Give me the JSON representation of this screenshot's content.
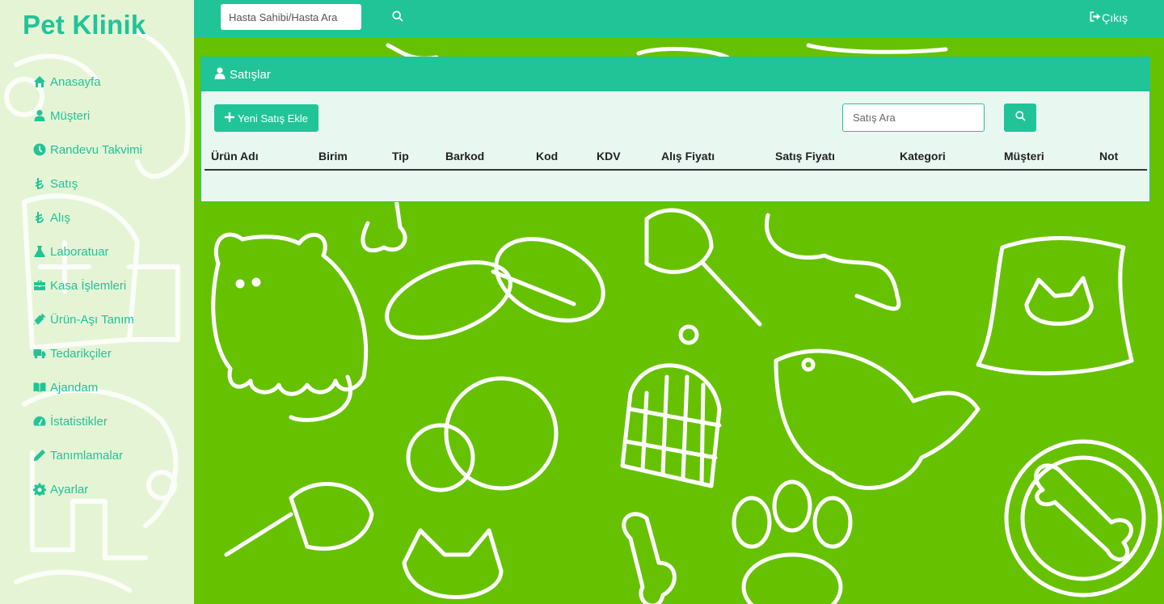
{
  "app": {
    "brand": "Pet Klinik"
  },
  "topbar": {
    "search_placeholder": "Hasta Sahibi/Hasta Ara",
    "logout_label": "Çıkış"
  },
  "sidebar": {
    "items": [
      {
        "label": "Anasayfa",
        "icon": "home-icon"
      },
      {
        "label": "Müşteri",
        "icon": "user-icon"
      },
      {
        "label": "Randevu Takvimi",
        "icon": "clock-icon"
      },
      {
        "label": "Satış",
        "icon": "lira-icon"
      },
      {
        "label": "Alış",
        "icon": "lira-icon"
      },
      {
        "label": "Laboratuar",
        "icon": "flask-icon"
      },
      {
        "label": "Kasa İşlemleri",
        "icon": "briefcase-icon"
      },
      {
        "label": "Ürün-Aşı Tanım",
        "icon": "syringe-icon"
      },
      {
        "label": "Tedarikçiler",
        "icon": "truck-icon"
      },
      {
        "label": "Ajandam",
        "icon": "book-icon"
      },
      {
        "label": "İstatistikler",
        "icon": "dashboard-icon"
      },
      {
        "label": "Tanımlamalar",
        "icon": "pencil-icon"
      },
      {
        "label": "Ayarlar",
        "icon": "gear-icon"
      }
    ]
  },
  "panel": {
    "title": "Satışlar",
    "add_button_label": "Yeni Satış Ekle",
    "search_placeholder": "Satış Ara",
    "columns": [
      "Ürün Adı",
      "Birim",
      "Tip",
      "Barkod",
      "Kod",
      "KDV",
      "Alış Fiyatı",
      "Satış Fiyatı",
      "Kategori",
      "Müşteri",
      "Not"
    ]
  },
  "colors": {
    "accent": "#20c497",
    "background": "#66c200",
    "sidebar_bg": "#e6f4d6",
    "panel_bg": "#e8f8f1"
  }
}
